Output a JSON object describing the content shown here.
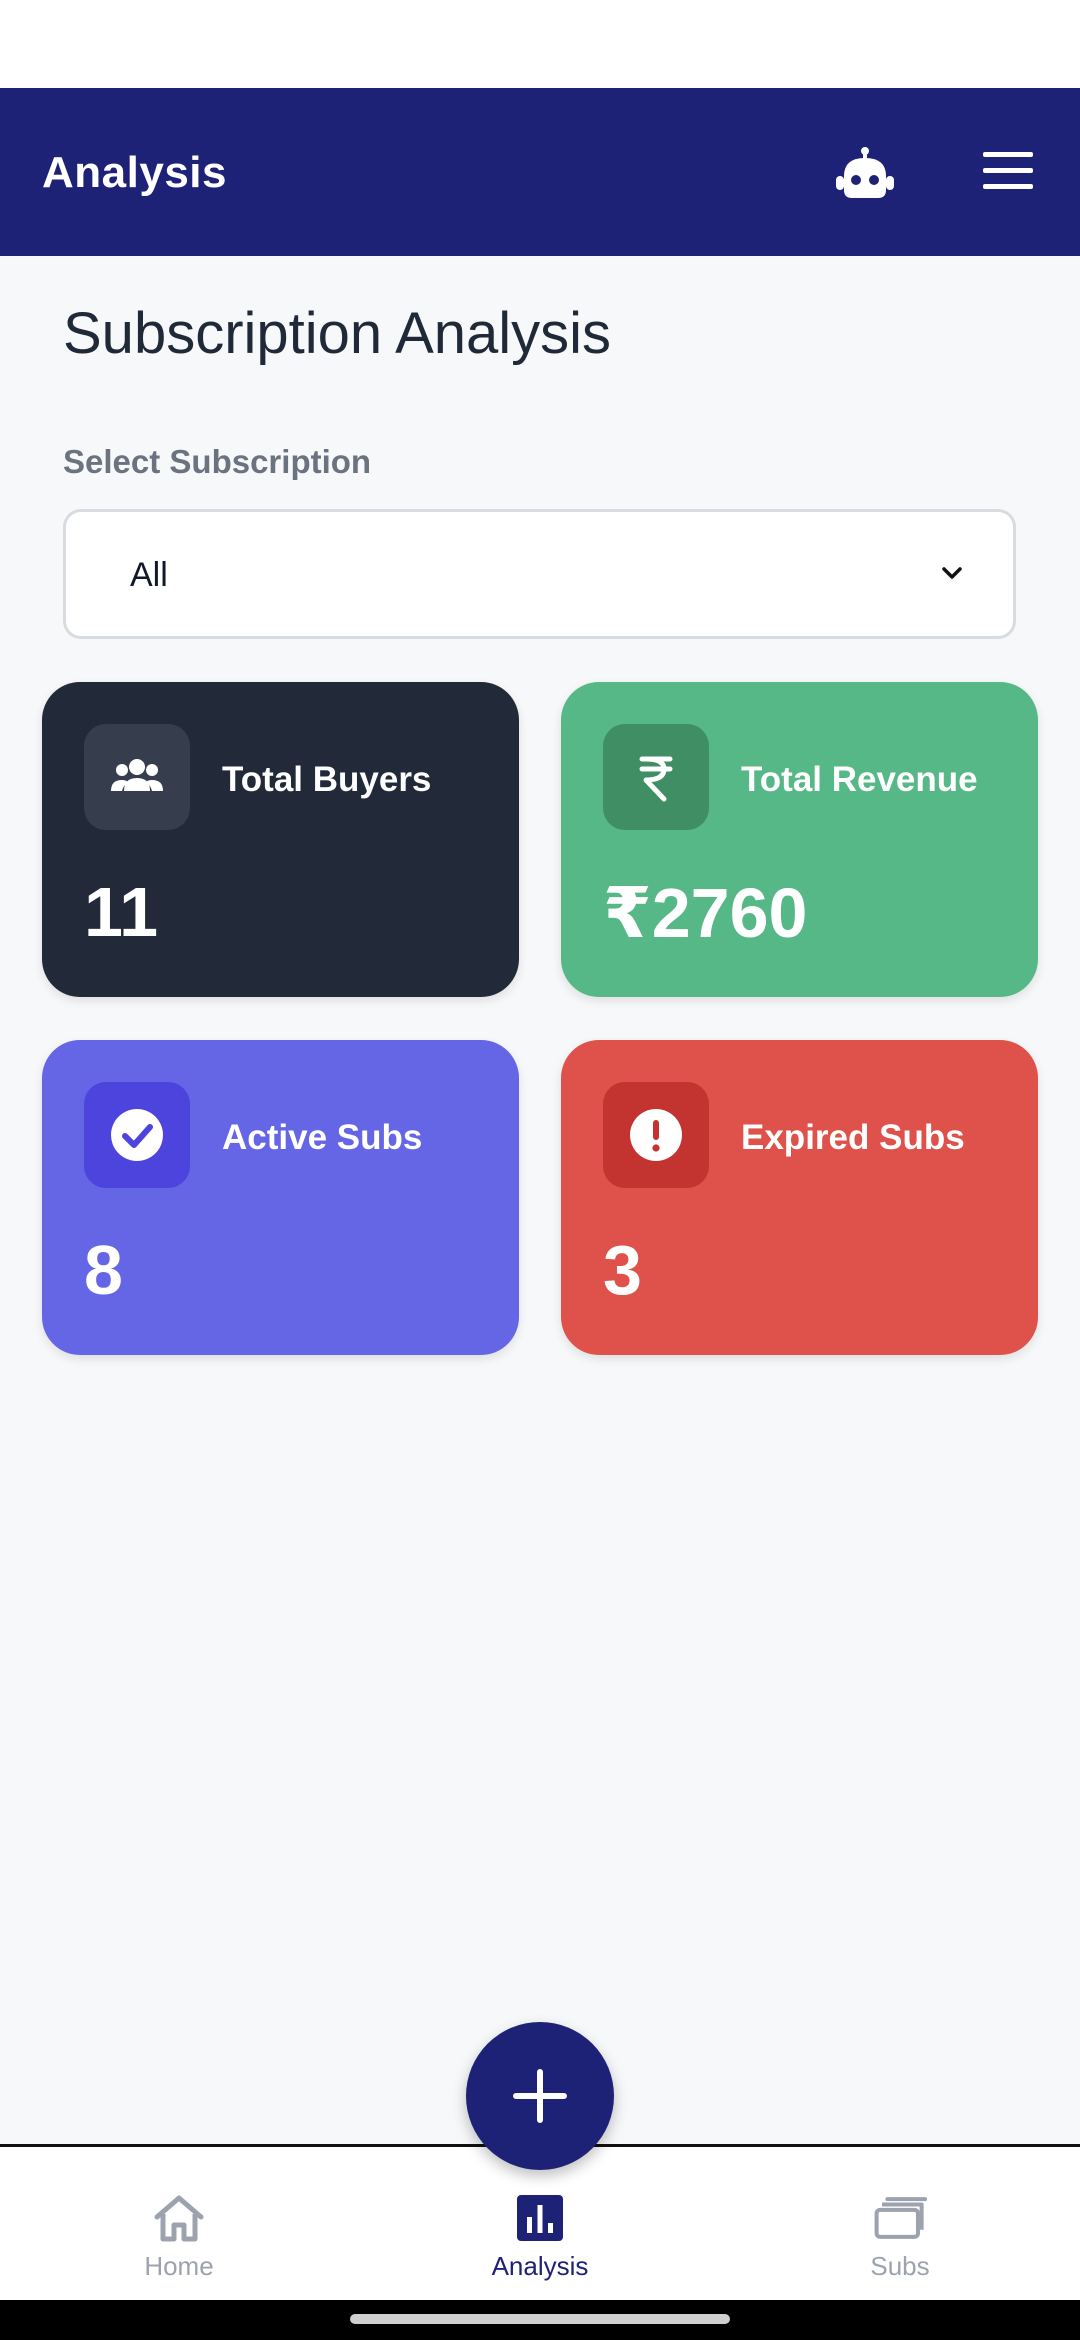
{
  "app_bar": {
    "title": "Analysis",
    "icons": [
      "robot-icon",
      "menu-icon"
    ]
  },
  "page": {
    "title": "Subscription Analysis",
    "select_label": "Select Subscription",
    "select_value": "All"
  },
  "cards": [
    {
      "label": "Total Buyers",
      "value": "11",
      "icon": "users-icon",
      "color": "#222a3a"
    },
    {
      "label": "Total Revenue",
      "value": "₹2760",
      "icon": "rupee-icon",
      "color": "#56b886"
    },
    {
      "label": "Active Subs",
      "value": "8",
      "icon": "check-circle-icon",
      "color": "#6566e5"
    },
    {
      "label": "Expired Subs",
      "value": "3",
      "icon": "alert-circle-icon",
      "color": "#df524b"
    }
  ],
  "bottom_nav": {
    "items": [
      {
        "label": "Home",
        "icon": "home-icon",
        "active": false
      },
      {
        "label": "Analysis",
        "icon": "bar-chart-icon",
        "active": true
      },
      {
        "label": "Subs",
        "icon": "stack-icon",
        "active": false
      }
    ]
  },
  "colors": {
    "primary": "#1e2277",
    "background": "#f7f8fa"
  }
}
